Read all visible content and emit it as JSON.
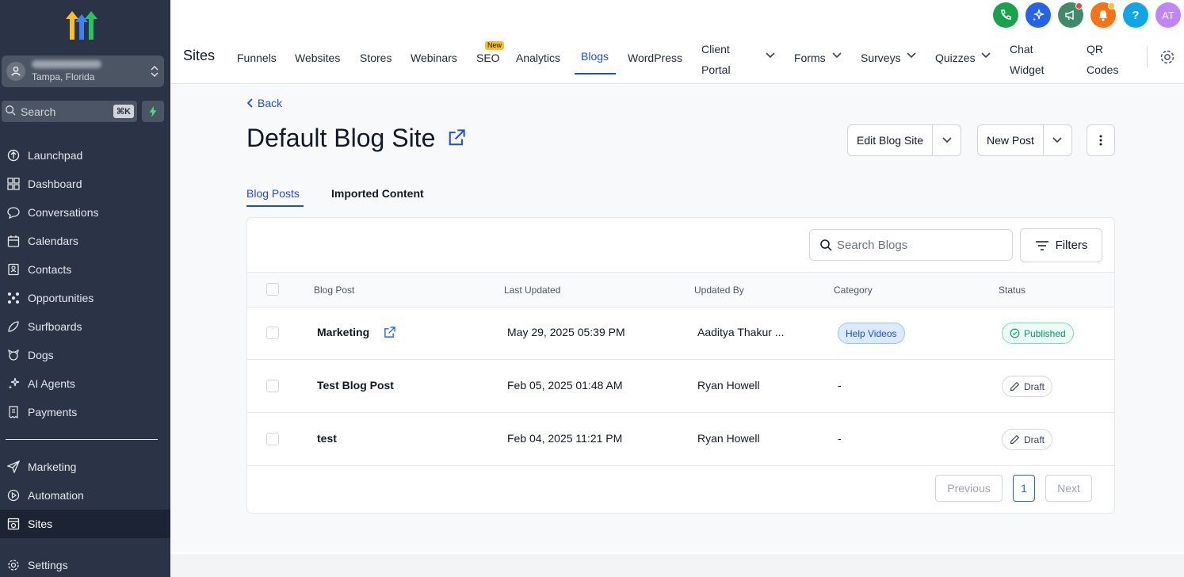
{
  "sidebar": {
    "location_city": "Tampa, Florida",
    "search_placeholder": "Search",
    "search_shortcut": "⌘K",
    "items": [
      {
        "label": "Launchpad",
        "icon": "rocket-icon"
      },
      {
        "label": "Dashboard",
        "icon": "grid-icon"
      },
      {
        "label": "Conversations",
        "icon": "chat-icon"
      },
      {
        "label": "Calendars",
        "icon": "calendar-icon"
      },
      {
        "label": "Contacts",
        "icon": "contacts-icon"
      },
      {
        "label": "Opportunities",
        "icon": "opportunities-icon"
      },
      {
        "label": "Surfboards",
        "icon": "surfboard-icon"
      },
      {
        "label": "Dogs",
        "icon": "dog-icon"
      },
      {
        "label": "AI Agents",
        "icon": "sparkle-icon"
      },
      {
        "label": "Payments",
        "icon": "receipt-icon"
      }
    ],
    "items2": [
      {
        "label": "Marketing",
        "icon": "send-icon"
      },
      {
        "label": "Automation",
        "icon": "automation-icon"
      },
      {
        "label": "Sites",
        "icon": "sites-icon"
      }
    ],
    "settings_label": "Settings"
  },
  "topbar": {
    "section_title": "Sites",
    "avatar_initials": "AT",
    "help_label": "?",
    "tabs": [
      {
        "label": "Funnels"
      },
      {
        "label": "Websites"
      },
      {
        "label": "Stores"
      },
      {
        "label": "Webinars"
      },
      {
        "label": "SEO",
        "badge": "New"
      },
      {
        "label": "Analytics"
      },
      {
        "label": "Blogs",
        "active": true
      },
      {
        "label": "WordPress"
      },
      {
        "label1": "Client",
        "label2": "Portal"
      },
      {
        "label": "Forms"
      },
      {
        "label": "Surveys"
      },
      {
        "label": "Quizzes"
      },
      {
        "label1": "Chat",
        "label2": "Widget"
      },
      {
        "label1": "QR",
        "label2": "Codes"
      }
    ]
  },
  "page": {
    "back_label": "Back",
    "title": "Default Blog Site",
    "edit_button": "Edit Blog Site",
    "new_post_button": "New Post",
    "subtabs": [
      "Blog Posts",
      "Imported Content"
    ],
    "search_placeholder": "Search Blogs",
    "filters_label": "Filters",
    "columns": [
      "Blog Post",
      "Last Updated",
      "Updated By",
      "Category",
      "Status"
    ],
    "rows": [
      {
        "title": "Marketing",
        "updated": "May 29, 2025 05:39 PM",
        "by": "Aaditya Thakur ...",
        "category": "Help Videos",
        "status": "Published"
      },
      {
        "title": "Test Blog Post",
        "updated": "Feb 05, 2025 01:48 AM",
        "by": "Ryan Howell",
        "category": "-",
        "status": "Draft"
      },
      {
        "title": "test",
        "updated": "Feb 04, 2025 11:21 PM",
        "by": "Ryan Howell",
        "category": "-",
        "status": "Draft"
      }
    ],
    "pagination": {
      "previous": "Previous",
      "current": "1",
      "next": "Next"
    }
  },
  "colors": {
    "sidebar": "#2a3446",
    "accent": "#1d4ed8",
    "published": "#059669"
  }
}
